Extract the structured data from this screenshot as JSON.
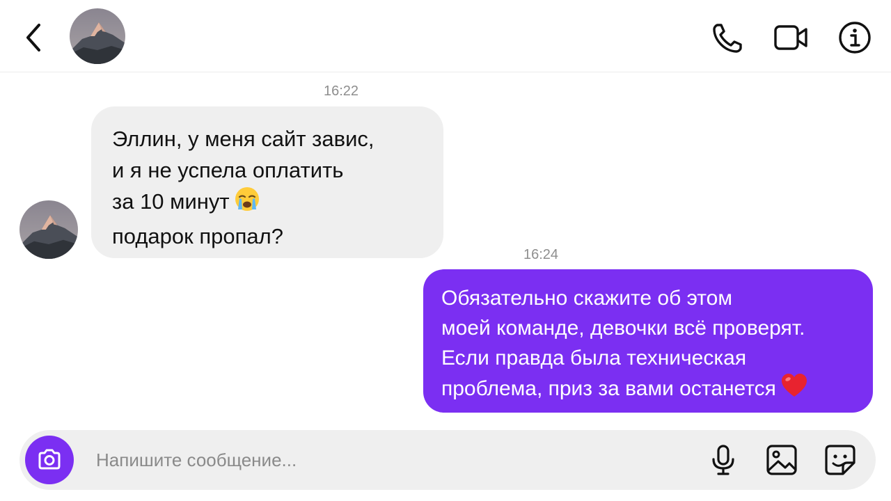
{
  "header": {
    "back_icon": "chevron-left-icon",
    "avatar": "mountain-avatar",
    "actions": [
      {
        "icon": "phone-icon"
      },
      {
        "icon": "video-camera-icon"
      },
      {
        "icon": "info-icon"
      }
    ]
  },
  "messages": [
    {
      "direction": "incoming",
      "timestamp": "16:22",
      "lines": [
        "Эллин, у меня сайт завис,",
        "и я не успела оплатить",
        "за 10 минут",
        "подарок пропал?"
      ],
      "emoji": "😭"
    },
    {
      "direction": "outgoing",
      "timestamp": "16:24",
      "lines": [
        "Обязательно скажите об этом",
        "моей команде, девочки всё проверят.",
        "Если правда была техническая",
        "проблема, приз за вами останется"
      ],
      "emoji": "❤️"
    }
  ],
  "composer": {
    "placeholder": "Напишите сообщение...",
    "value": "",
    "icons": [
      "camera-icon",
      "microphone-icon",
      "gallery-icon",
      "sticker-icon"
    ]
  },
  "colors": {
    "accent": "#7B2FF2",
    "incoming_bubble": "#EFEFEF",
    "timestamp": "#8E8E8E",
    "composer_bg": "#EFEFEF"
  }
}
